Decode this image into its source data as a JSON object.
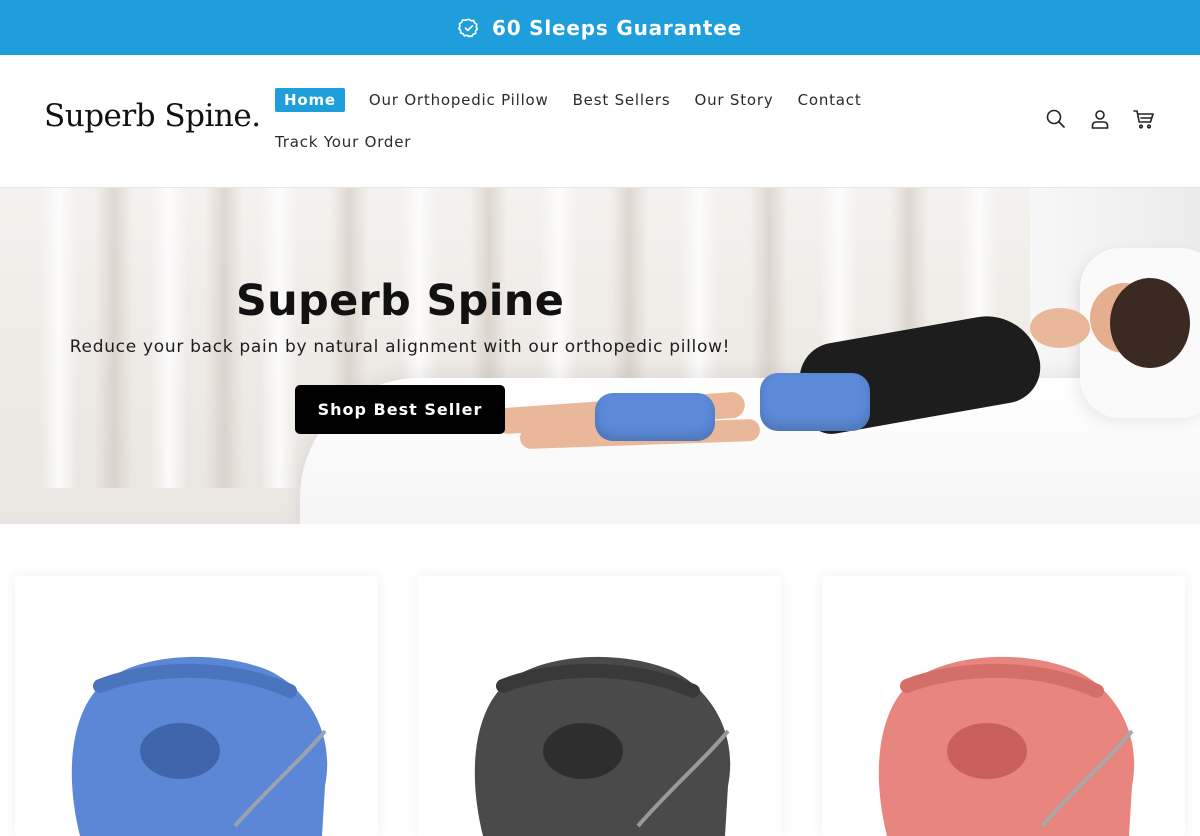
{
  "announcement": {
    "icon": "verified-badge-icon",
    "text": "60 Sleeps Guarantee",
    "background": "#1e9fdc"
  },
  "header": {
    "logo": "Superb Spine.",
    "nav": [
      {
        "label": "Home",
        "active": true
      },
      {
        "label": "Our Orthopedic Pillow",
        "active": false
      },
      {
        "label": "Best Sellers",
        "active": false
      },
      {
        "label": "Our Story",
        "active": false
      },
      {
        "label": "Contact",
        "active": false
      },
      {
        "label": "Track Your Order",
        "active": false
      }
    ],
    "icons": [
      "search-icon",
      "account-icon",
      "cart-icon"
    ],
    "accent": "#1e9fdc"
  },
  "hero": {
    "title": "Superb Spine",
    "subtitle": "Reduce your back pain by natural alignment with our orthopedic pillow!",
    "button_label": "Shop Best Seller"
  },
  "products": [
    {
      "color": "#5b87d6"
    },
    {
      "color": "#4a4a4a"
    },
    {
      "color": "#e8857f"
    }
  ]
}
